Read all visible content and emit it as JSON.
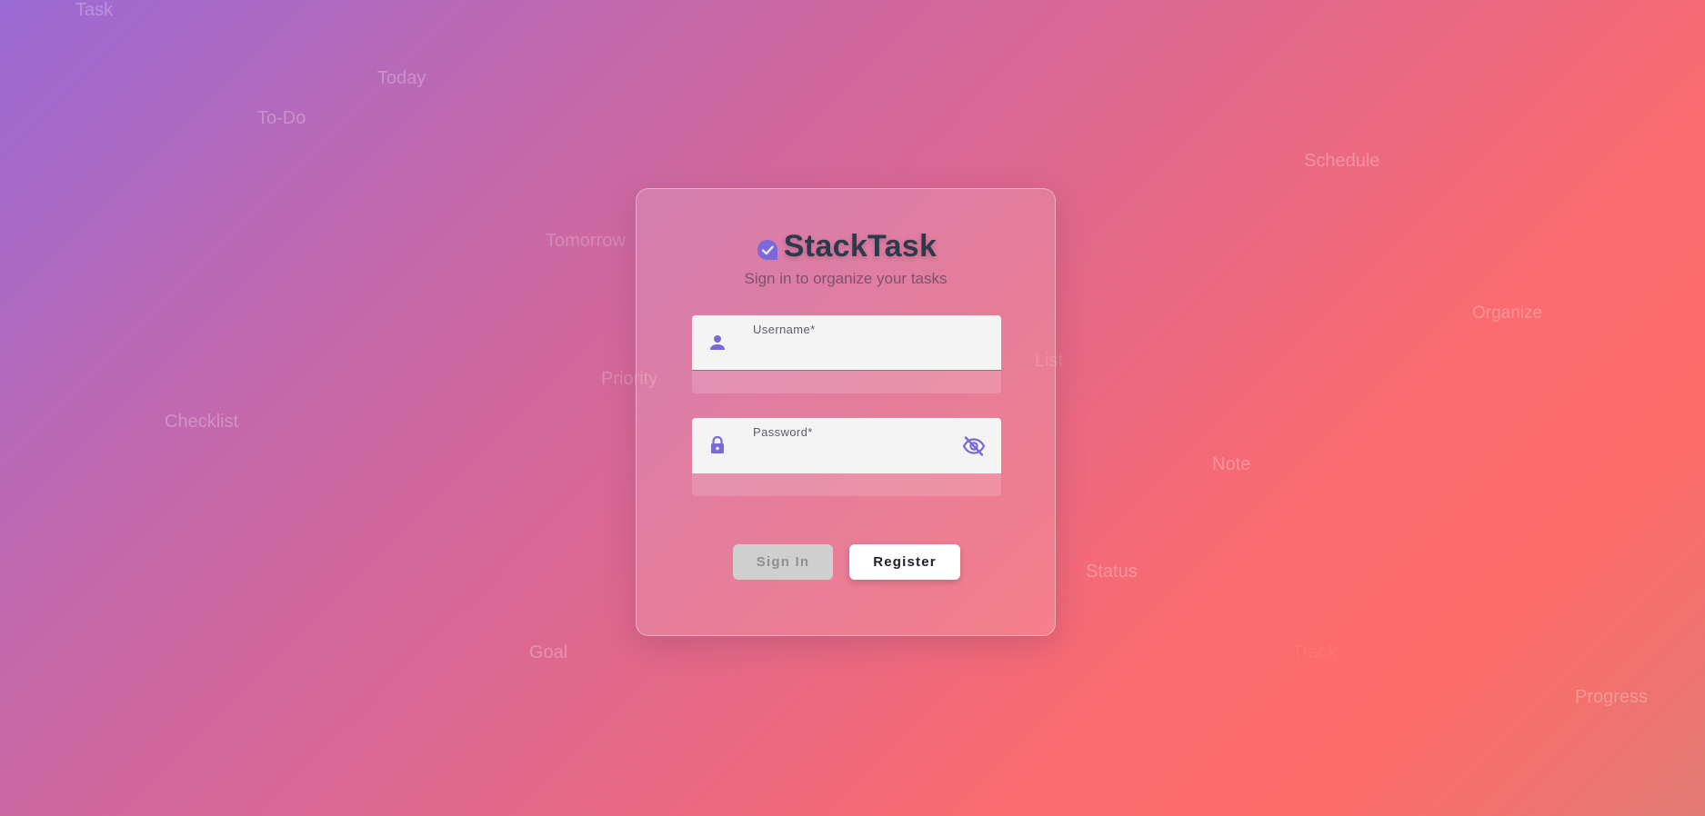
{
  "background_words": [
    "Task",
    "Today",
    "To-Do",
    "Tomorrow",
    "Schedule",
    "Organize",
    "Priority",
    "List",
    "Checklist",
    "Note",
    "Status",
    "Goal",
    "Track",
    "Progress"
  ],
  "app": {
    "title": "StackTask",
    "subtitle": "Sign in to organize your tasks",
    "logo_icon": "check-badge-icon",
    "accent_color": "#7b68d9",
    "title_color": "#2e3a4b"
  },
  "form": {
    "username": {
      "label": "Username*",
      "value": "",
      "icon": "person-icon"
    },
    "password": {
      "label": "Password*",
      "value": "",
      "icon": "lock-icon",
      "toggle_icon": "eye-off-icon"
    }
  },
  "buttons": {
    "sign_in": "Sign In",
    "register": "Register"
  }
}
